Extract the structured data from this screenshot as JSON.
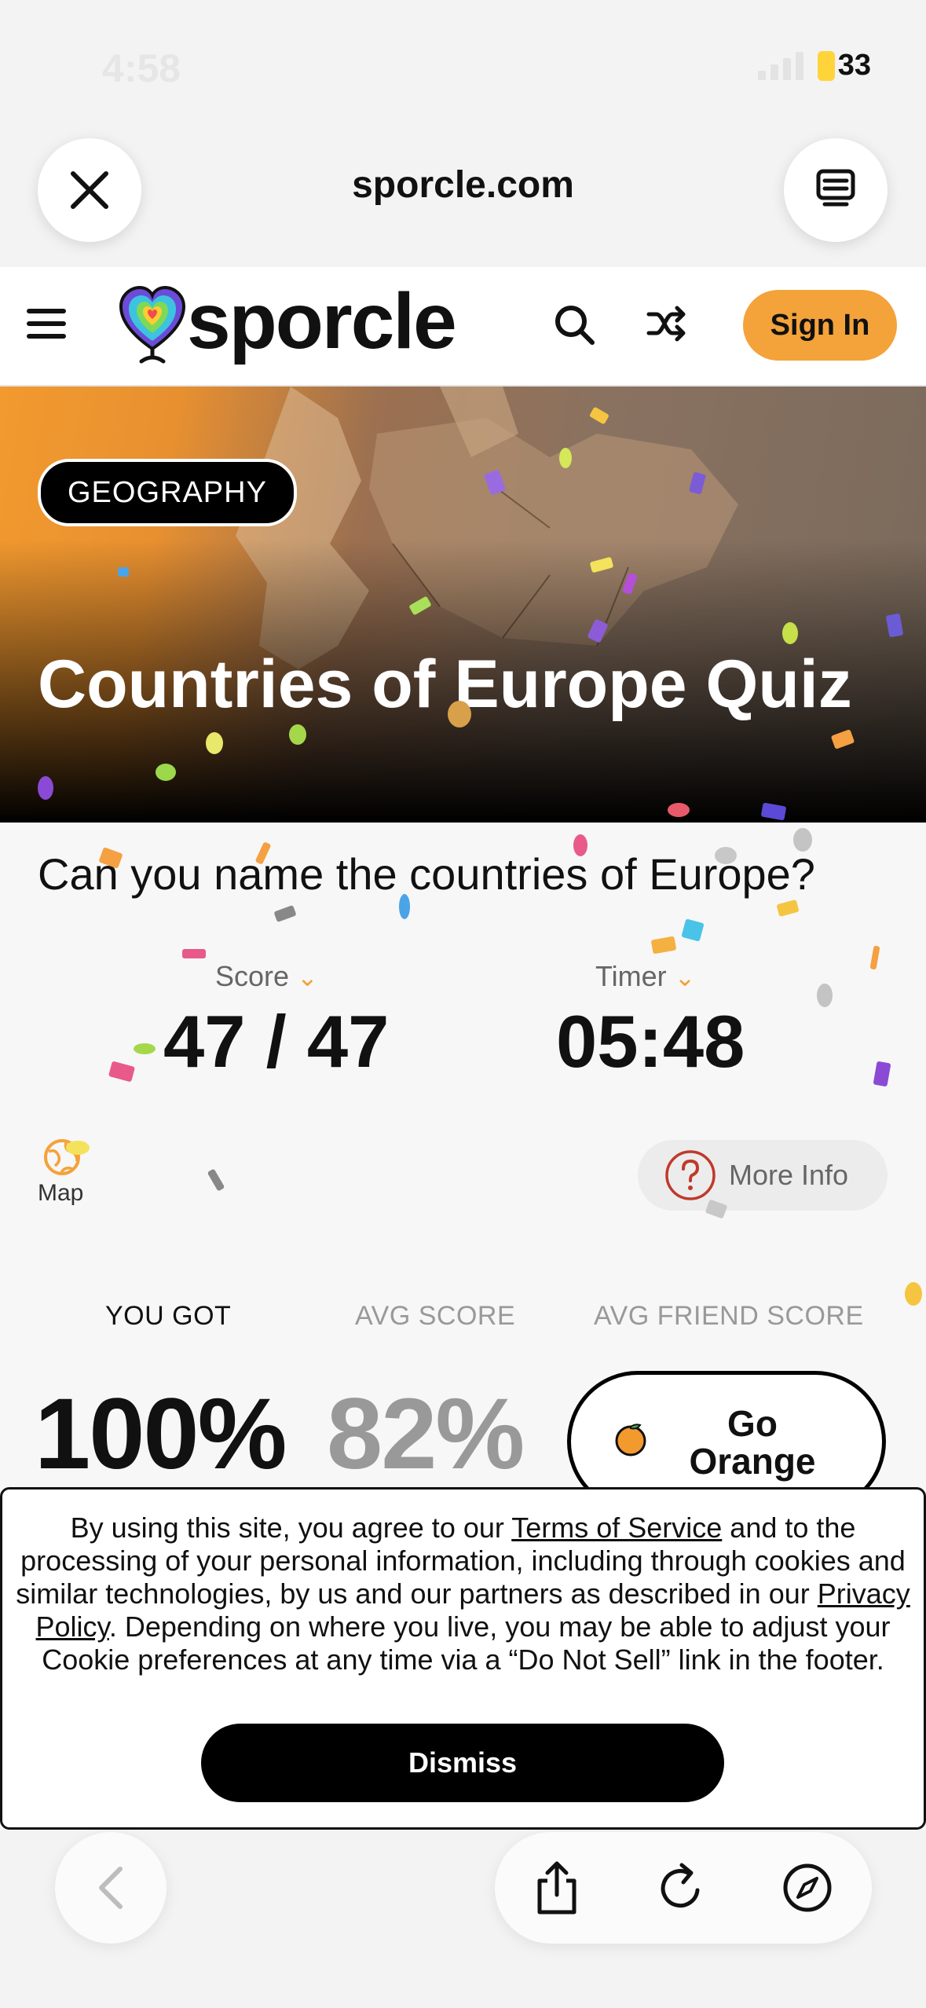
{
  "status_bar": {
    "time": "4:58",
    "battery": "33"
  },
  "browser": {
    "url": "sporcle.com"
  },
  "site": {
    "logo": "sporcle",
    "sign_in": "Sign In"
  },
  "quiz": {
    "category": "GEOGRAPHY",
    "title": "Countries of Europe Quiz",
    "question": "Can you name the countries of Europe?",
    "score_label": "Score",
    "score": "47 / 47",
    "timer_label": "Timer",
    "timer": "05:48",
    "map_label": "Map",
    "more_info": "More Info"
  },
  "results": {
    "you_got_label": "YOU GOT",
    "you_got": "100%",
    "avg_label": "AVG SCORE",
    "avg": "82%",
    "friend_label": "AVG FRIEND SCORE",
    "go_orange": "Go Orange"
  },
  "cookie": {
    "text_1": "By using this site, you agree to our ",
    "terms_link": "Terms of Service",
    "text_2": " and to the processing of your personal information, including through cookies and similar technologies, by us and our partners as described in our ",
    "privacy_link": "Privacy Policy",
    "text_3": ". Depending on where you live, you may be able to adjust your Cookie preferences at any time via a “Do Not Sell” link in the footer.",
    "dismiss": "Dismiss"
  },
  "colors": {
    "accent": "#f4a23a",
    "text": "#111111",
    "muted": "#999999"
  },
  "icons": [
    "close-icon",
    "reader-mode-icon",
    "menu-icon",
    "search-icon",
    "shuffle-icon",
    "map-icon",
    "help-icon",
    "orange-icon",
    "back-icon",
    "share-icon",
    "reload-icon",
    "compass-icon"
  ]
}
